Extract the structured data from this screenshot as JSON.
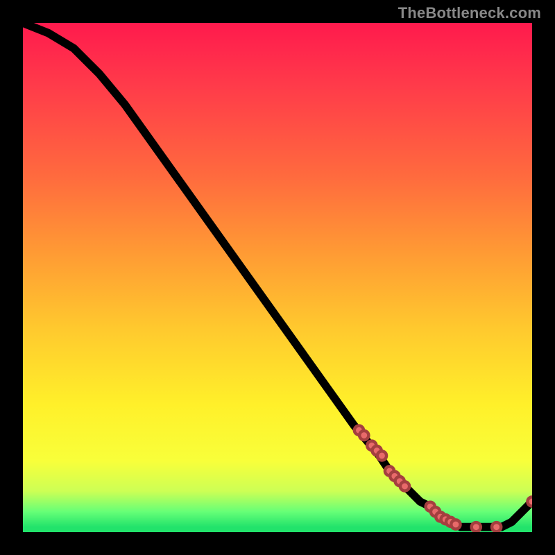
{
  "watermark": "TheBottleneck.com",
  "colors": {
    "marker_fill": "#e86a6a",
    "marker_stroke": "#a43f3f",
    "curve": "#000000"
  },
  "chart_data": {
    "type": "line",
    "title": "",
    "xlabel": "",
    "ylabel": "",
    "xlim": [
      0,
      100
    ],
    "ylim": [
      0,
      100
    ],
    "grid": false,
    "series": [
      {
        "name": "curve",
        "x": [
          0,
          5,
          10,
          15,
          20,
          25,
          30,
          35,
          40,
          45,
          50,
          55,
          60,
          65,
          70,
          72,
          74,
          76,
          78,
          80,
          82,
          84,
          86,
          88,
          90,
          92,
          94,
          96,
          98,
          100
        ],
        "values": [
          100,
          98,
          95,
          90,
          84,
          77,
          70,
          63,
          56,
          49,
          42,
          35,
          28,
          21,
          15,
          12,
          10,
          8,
          6,
          5,
          3,
          2,
          1,
          1,
          1,
          1,
          1,
          2,
          4,
          6
        ]
      }
    ],
    "markers": [
      {
        "x": 66,
        "y": 20
      },
      {
        "x": 67,
        "y": 19
      },
      {
        "x": 68.5,
        "y": 17
      },
      {
        "x": 69.5,
        "y": 16
      },
      {
        "x": 70.5,
        "y": 15
      },
      {
        "x": 72,
        "y": 12
      },
      {
        "x": 73,
        "y": 11
      },
      {
        "x": 74,
        "y": 10
      },
      {
        "x": 75,
        "y": 9
      },
      {
        "x": 80,
        "y": 5
      },
      {
        "x": 81,
        "y": 4
      },
      {
        "x": 82,
        "y": 3
      },
      {
        "x": 83,
        "y": 2.5
      },
      {
        "x": 84,
        "y": 2
      },
      {
        "x": 85,
        "y": 1.5
      },
      {
        "x": 89,
        "y": 1
      },
      {
        "x": 93,
        "y": 1
      },
      {
        "x": 100,
        "y": 6
      }
    ]
  }
}
